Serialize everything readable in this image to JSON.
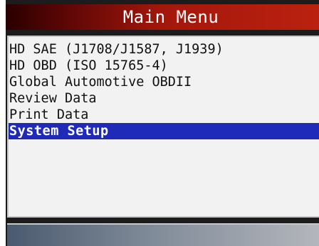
{
  "header": {
    "title": "Main Menu"
  },
  "menu": {
    "items": [
      {
        "label": "HD SAE (J1708/J1587, J1939)"
      },
      {
        "label": "HD OBD (ISO 15765-4)"
      },
      {
        "label": "Global Automotive OBDII"
      },
      {
        "label": "Review Data"
      },
      {
        "label": "Print Data"
      },
      {
        "label": "System Setup"
      }
    ],
    "selected_index": 5
  },
  "colors": {
    "title_bar": "#a3170b",
    "selection_highlight": "#1f2bb8",
    "panel_background": "#f2f2f2",
    "frame": "#1c1c1c"
  }
}
